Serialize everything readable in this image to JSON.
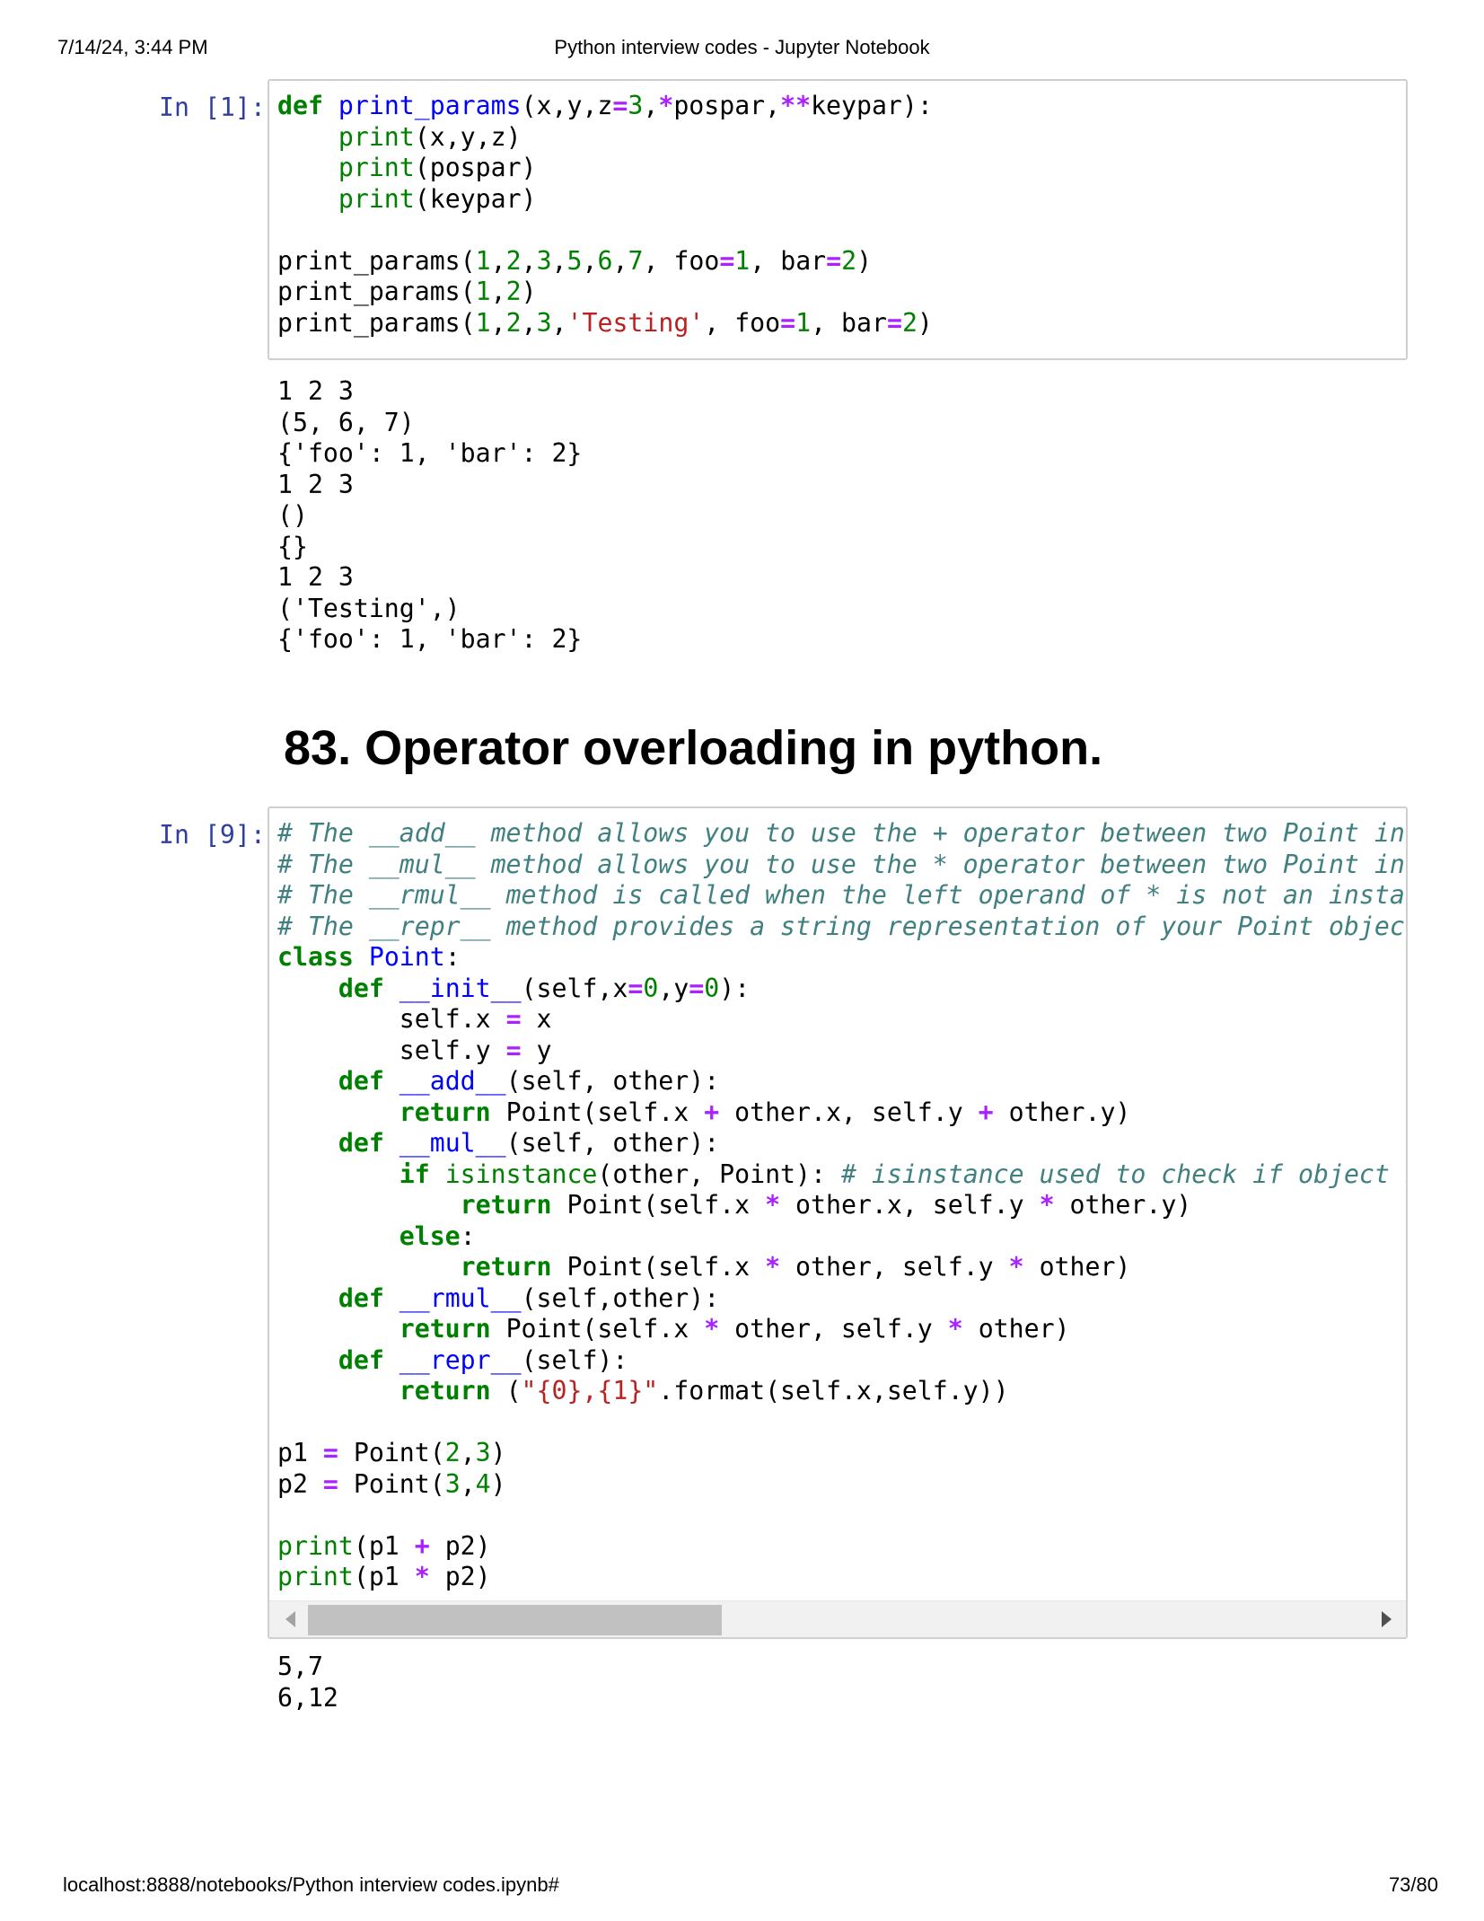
{
  "print_header": {
    "datetime": "7/14/24, 3:44 PM",
    "title": "Python interview codes - Jupyter Notebook"
  },
  "print_footer": {
    "url": "localhost:8888/notebooks/Python interview codes.ipynb#",
    "page": "73/80"
  },
  "cell1": {
    "prompt": "In [1]:",
    "code_lines": [
      [
        [
          "kw",
          "def"
        ],
        [
          "t",
          " "
        ],
        [
          "fn",
          "print_params"
        ],
        [
          "t",
          "(x,y,z"
        ],
        [
          "op",
          "="
        ],
        [
          "num",
          "3"
        ],
        [
          "t",
          ","
        ],
        [
          "op",
          "*"
        ],
        [
          "t",
          "pospar,"
        ],
        [
          "op",
          "**"
        ],
        [
          "t",
          "keypar):"
        ]
      ],
      [
        [
          "t",
          "    "
        ],
        [
          "bi",
          "print"
        ],
        [
          "t",
          "(x,y,z)"
        ]
      ],
      [
        [
          "t",
          "    "
        ],
        [
          "bi",
          "print"
        ],
        [
          "t",
          "(pospar)"
        ]
      ],
      [
        [
          "t",
          "    "
        ],
        [
          "bi",
          "print"
        ],
        [
          "t",
          "(keypar)"
        ]
      ],
      [],
      [
        [
          "t",
          "print_params("
        ],
        [
          "num",
          "1"
        ],
        [
          "t",
          ","
        ],
        [
          "num",
          "2"
        ],
        [
          "t",
          ","
        ],
        [
          "num",
          "3"
        ],
        [
          "t",
          ","
        ],
        [
          "num",
          "5"
        ],
        [
          "t",
          ","
        ],
        [
          "num",
          "6"
        ],
        [
          "t",
          ","
        ],
        [
          "num",
          "7"
        ],
        [
          "t",
          ", foo"
        ],
        [
          "op",
          "="
        ],
        [
          "num",
          "1"
        ],
        [
          "t",
          ", bar"
        ],
        [
          "op",
          "="
        ],
        [
          "num",
          "2"
        ],
        [
          "t",
          ")"
        ]
      ],
      [
        [
          "t",
          "print_params("
        ],
        [
          "num",
          "1"
        ],
        [
          "t",
          ","
        ],
        [
          "num",
          "2"
        ],
        [
          "t",
          ")"
        ]
      ],
      [
        [
          "t",
          "print_params("
        ],
        [
          "num",
          "1"
        ],
        [
          "t",
          ","
        ],
        [
          "num",
          "2"
        ],
        [
          "t",
          ","
        ],
        [
          "num",
          "3"
        ],
        [
          "t",
          ","
        ],
        [
          "str",
          "'Testing'"
        ],
        [
          "t",
          ", foo"
        ],
        [
          "op",
          "="
        ],
        [
          "num",
          "1"
        ],
        [
          "t",
          ", bar"
        ],
        [
          "op",
          "="
        ],
        [
          "num",
          "2"
        ],
        [
          "t",
          ")"
        ]
      ]
    ],
    "output_lines": [
      "1 2 3",
      "(5, 6, 7)",
      "{'foo': 1, 'bar': 2}",
      "1 2 3",
      "()",
      "{}",
      "1 2 3",
      "('Testing',)",
      "{'foo': 1, 'bar': 2}"
    ]
  },
  "section_heading": "83. Operator overloading in python.",
  "cell2": {
    "prompt": "In [9]:",
    "code_lines": [
      [
        [
          "cm",
          "# The __add__ method allows you to use the + operator between two Point instances"
        ]
      ],
      [
        [
          "cm",
          "# The __mul__ method allows you to use the * operator between two Point instances"
        ]
      ],
      [
        [
          "cm",
          "# The __rmul__ method is called when the left operand of * is not an instance of"
        ]
      ],
      [
        [
          "cm",
          "# The __repr__ method provides a string representation of your Point object."
        ]
      ],
      [
        [
          "kw",
          "class"
        ],
        [
          "t",
          " "
        ],
        [
          "fn",
          "Point"
        ],
        [
          "t",
          ":"
        ]
      ],
      [
        [
          "t",
          "    "
        ],
        [
          "kw",
          "def"
        ],
        [
          "t",
          " "
        ],
        [
          "fn",
          "__init__"
        ],
        [
          "t",
          "(self,x"
        ],
        [
          "op",
          "="
        ],
        [
          "num",
          "0"
        ],
        [
          "t",
          ",y"
        ],
        [
          "op",
          "="
        ],
        [
          "num",
          "0"
        ],
        [
          "t",
          "):"
        ]
      ],
      [
        [
          "t",
          "        self.x "
        ],
        [
          "op",
          "="
        ],
        [
          "t",
          " x"
        ]
      ],
      [
        [
          "t",
          "        self.y "
        ],
        [
          "op",
          "="
        ],
        [
          "t",
          " y"
        ]
      ],
      [
        [
          "t",
          "    "
        ],
        [
          "kw",
          "def"
        ],
        [
          "t",
          " "
        ],
        [
          "fn",
          "__add__"
        ],
        [
          "t",
          "(self, other):"
        ]
      ],
      [
        [
          "t",
          "        "
        ],
        [
          "kw",
          "return"
        ],
        [
          "t",
          " Point(self.x "
        ],
        [
          "op",
          "+"
        ],
        [
          "t",
          " other.x, self.y "
        ],
        [
          "op",
          "+"
        ],
        [
          "t",
          " other.y)"
        ]
      ],
      [
        [
          "t",
          "    "
        ],
        [
          "kw",
          "def"
        ],
        [
          "t",
          " "
        ],
        [
          "fn",
          "__mul__"
        ],
        [
          "t",
          "(self, other):"
        ]
      ],
      [
        [
          "t",
          "        "
        ],
        [
          "kw",
          "if"
        ],
        [
          "t",
          " "
        ],
        [
          "bi",
          "isinstance"
        ],
        [
          "t",
          "(other, Point): "
        ],
        [
          "cm",
          "# isinstance used to check if object is inst"
        ]
      ],
      [
        [
          "t",
          "            "
        ],
        [
          "kw",
          "return"
        ],
        [
          "t",
          " Point(self.x "
        ],
        [
          "op",
          "*"
        ],
        [
          "t",
          " other.x, self.y "
        ],
        [
          "op",
          "*"
        ],
        [
          "t",
          " other.y)"
        ]
      ],
      [
        [
          "t",
          "        "
        ],
        [
          "kw",
          "else"
        ],
        [
          "t",
          ":"
        ]
      ],
      [
        [
          "t",
          "            "
        ],
        [
          "kw",
          "return"
        ],
        [
          "t",
          " Point(self.x "
        ],
        [
          "op",
          "*"
        ],
        [
          "t",
          " other, self.y "
        ],
        [
          "op",
          "*"
        ],
        [
          "t",
          " other)"
        ]
      ],
      [
        [
          "t",
          "    "
        ],
        [
          "kw",
          "def"
        ],
        [
          "t",
          " "
        ],
        [
          "fn",
          "__rmul__"
        ],
        [
          "t",
          "(self,other):"
        ]
      ],
      [
        [
          "t",
          "        "
        ],
        [
          "kw",
          "return"
        ],
        [
          "t",
          " Point(self.x "
        ],
        [
          "op",
          "*"
        ],
        [
          "t",
          " other, self.y "
        ],
        [
          "op",
          "*"
        ],
        [
          "t",
          " other)"
        ]
      ],
      [
        [
          "t",
          "    "
        ],
        [
          "kw",
          "def"
        ],
        [
          "t",
          " "
        ],
        [
          "fn",
          "__repr__"
        ],
        [
          "t",
          "(self):"
        ]
      ],
      [
        [
          "t",
          "        "
        ],
        [
          "kw",
          "return"
        ],
        [
          "t",
          " ("
        ],
        [
          "str",
          "\"{0},{1}\""
        ],
        [
          "t",
          ".format(self.x,self.y))"
        ]
      ],
      [],
      [
        [
          "t",
          "p1 "
        ],
        [
          "op",
          "="
        ],
        [
          "t",
          " Point("
        ],
        [
          "num",
          "2"
        ],
        [
          "t",
          ","
        ],
        [
          "num",
          "3"
        ],
        [
          "t",
          ")"
        ]
      ],
      [
        [
          "t",
          "p2 "
        ],
        [
          "op",
          "="
        ],
        [
          "t",
          " Point("
        ],
        [
          "num",
          "3"
        ],
        [
          "t",
          ","
        ],
        [
          "num",
          "4"
        ],
        [
          "t",
          ")"
        ]
      ],
      [],
      [
        [
          "bi",
          "print"
        ],
        [
          "t",
          "(p1 "
        ],
        [
          "op",
          "+"
        ],
        [
          "t",
          " p2)"
        ]
      ],
      [
        [
          "bi",
          "print"
        ],
        [
          "t",
          "(p1 "
        ],
        [
          "op",
          "*"
        ],
        [
          "t",
          " p2)"
        ]
      ]
    ],
    "scrollbar": {
      "thumb_fraction": 0.39,
      "scroll_position": 0
    },
    "output_lines": [
      "5,7",
      "6,12"
    ]
  }
}
